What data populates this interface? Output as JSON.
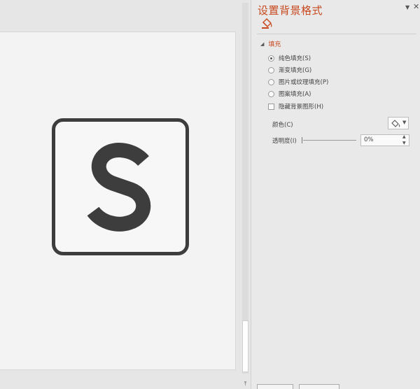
{
  "slide": {
    "logo_letter": "S"
  },
  "pane": {
    "title": "设置背景格式",
    "section_fill": "填充",
    "fill_options": [
      {
        "label": "纯色填充(S)",
        "checked": true
      },
      {
        "label": "渐变填充(G)",
        "checked": false
      },
      {
        "label": "图片或纹理填充(P)",
        "checked": false
      },
      {
        "label": "图案填充(A)",
        "checked": false
      }
    ],
    "hide_background_graphics": "隐藏背景图形(H)",
    "color_label": "颜色(C)",
    "transparency_label": "透明度(I)",
    "transparency_value": "0%",
    "icons": {
      "dropdown": "chevron-down-icon",
      "close": "close-icon",
      "fill_tab": "paint-bucket-icon"
    },
    "accent_color": "#c8491f"
  }
}
